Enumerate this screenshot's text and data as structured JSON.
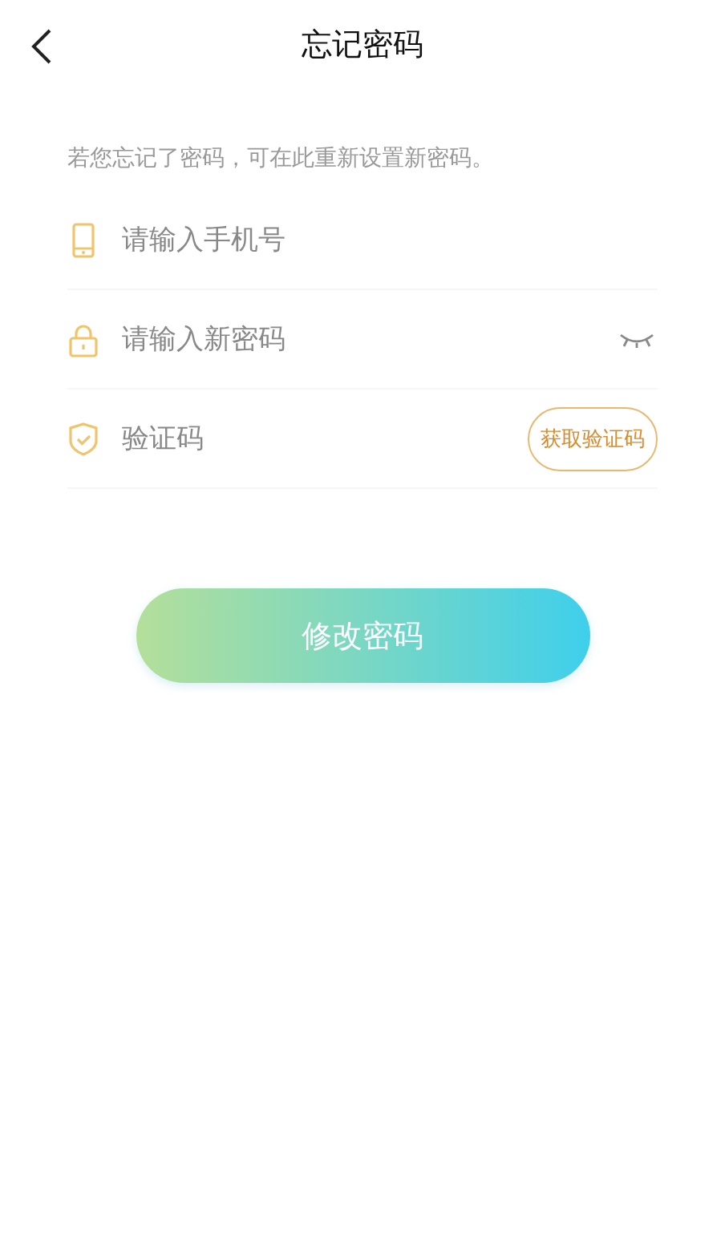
{
  "header": {
    "title": "忘记密码"
  },
  "hint": "若您忘记了密码，可在此重新设置新密码。",
  "fields": [
    {
      "kind": "phone",
      "placeholder": "请输入手机号"
    },
    {
      "kind": "password",
      "placeholder": "请输入新密码"
    },
    {
      "kind": "code",
      "placeholder": "验证码",
      "action": "获取验证码"
    }
  ],
  "submit": "修改密码"
}
